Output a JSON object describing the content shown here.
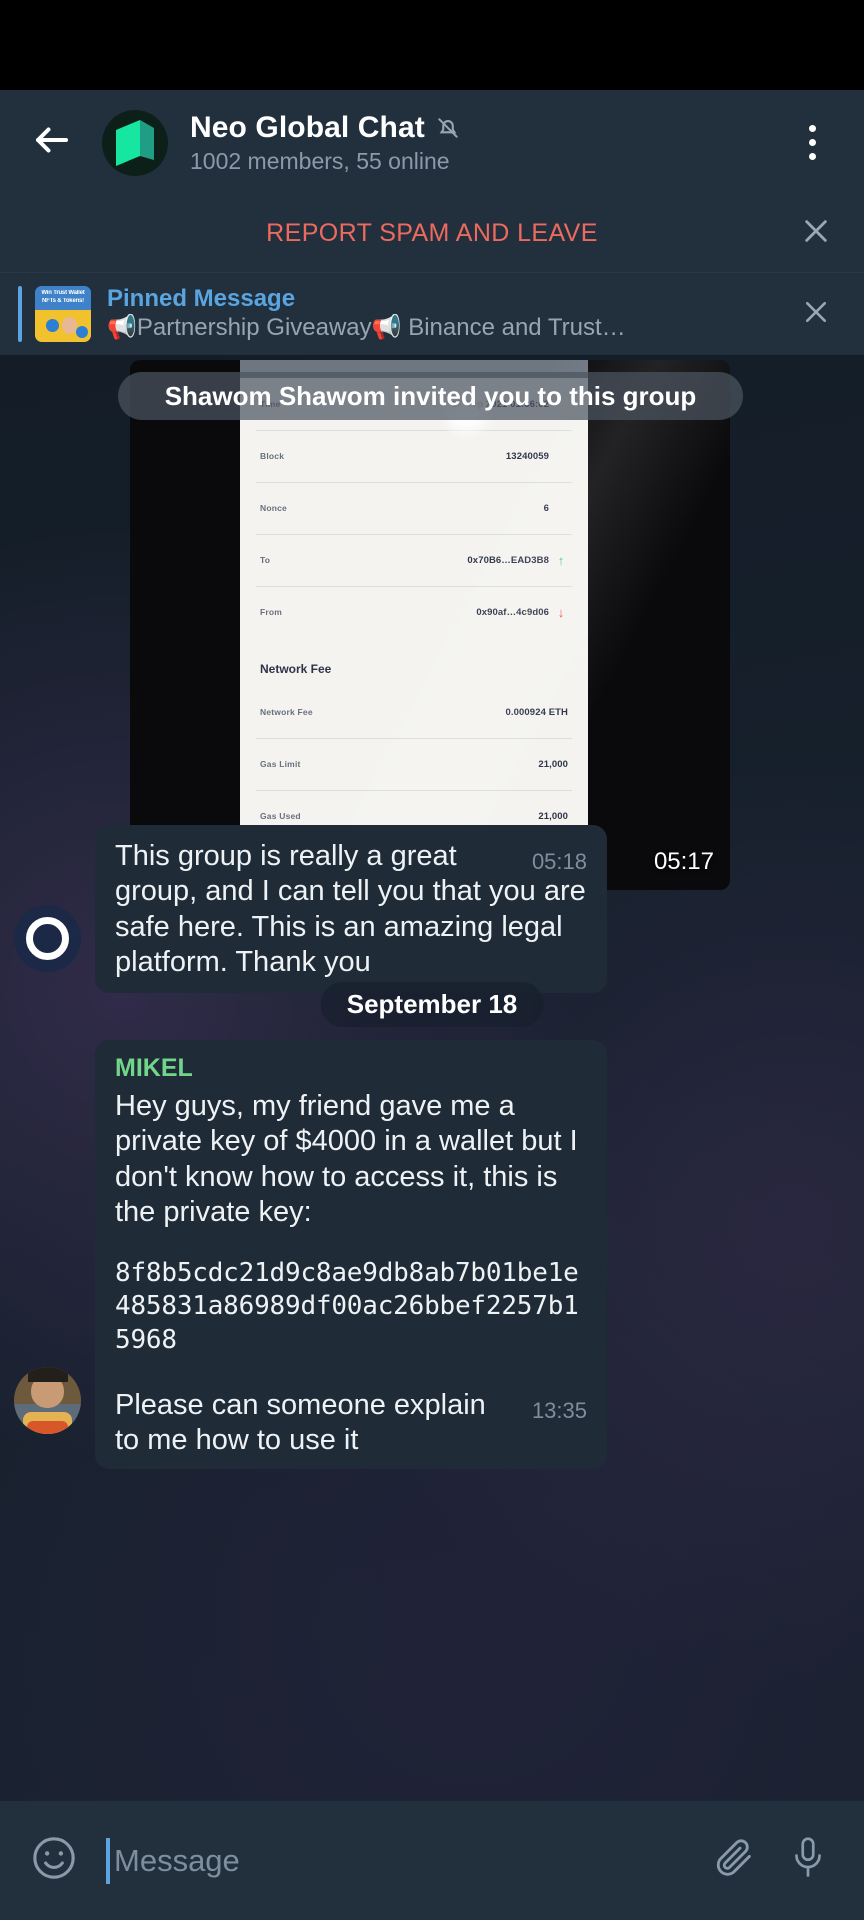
{
  "header": {
    "back_icon": "arrow-left-icon",
    "avatar_icon": "neo-logo-icon",
    "title": "Neo Global Chat",
    "mute_icon": "muted-bell-icon",
    "subtitle": "1002 members, 55 online",
    "menu_icon": "overflow-menu-icon"
  },
  "spam_bar": {
    "label": "REPORT SPAM AND LEAVE",
    "close_icon": "close-icon",
    "color": "#ec6a5e"
  },
  "pinned": {
    "title": "Pinned Message",
    "snippet": "📢Partnership Giveaway📢  Binance and Trust…",
    "thumb_line1": "Win Trust Wallet",
    "thumb_line2": "NFTs & Tokens!",
    "close_icon": "close-icon",
    "accent_color": "#5aa4e0"
  },
  "invite_banner": {
    "text": "Shawom Shawom invited you to this group"
  },
  "photo_message": {
    "timestamp": "05:17",
    "transaction": {
      "rows": [
        {
          "label": "Time",
          "value": "17 Sep 2021 01:36:02",
          "arrow": ""
        },
        {
          "label": "Block",
          "value": "13240059",
          "arrow": ""
        },
        {
          "label": "Nonce",
          "value": "6",
          "arrow": ""
        },
        {
          "label": "To",
          "value": "0x70B6…EAD3B8",
          "arrow": "↑"
        },
        {
          "label": "From",
          "value": "0x90af…4c9d06",
          "arrow": "↓"
        }
      ],
      "fee_heading": "Network Fee",
      "fee_rows": [
        {
          "label": "Network Fee",
          "value": "0.000924 ETH"
        },
        {
          "label": "Gas Limit",
          "value": "21,000"
        },
        {
          "label": "Gas Used",
          "value": "21,000"
        }
      ]
    }
  },
  "messages": {
    "safe": {
      "body": "This group is really a great group, and I can tell you that you are safe here. This is an amazing legal platform. Thank you",
      "timestamp": "05:18",
      "avatar_icon": "ring-avatar-icon"
    },
    "date_divider": "September 18",
    "mikel": {
      "sender": "MIKEL",
      "sender_color": "#72d68a",
      "body": "Hey guys, my friend gave me a private key of $4000 in a wallet but I don't know how to access it, this is the private key:",
      "private_key": "8f8b5cdc21d9c8ae9db8ab7b01be1e485831a86989df00ac26bbef2257b15968",
      "followup": "Please can someone explain to me how to use it",
      "timestamp": "13:35",
      "avatar_icon": "user-photo-avatar"
    }
  },
  "input_bar": {
    "emoji_icon": "smiley-icon",
    "placeholder": "Message",
    "attach_icon": "paperclip-icon",
    "mic_icon": "microphone-icon"
  }
}
